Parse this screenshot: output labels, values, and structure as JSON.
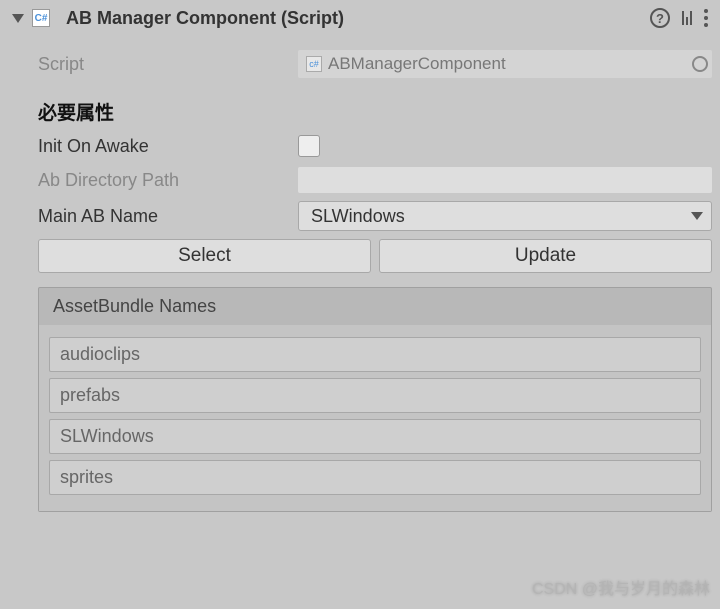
{
  "header": {
    "title": "AB Manager Component (Script)"
  },
  "script": {
    "label": "Script",
    "value": "ABManagerComponent"
  },
  "section_title": "必要属性",
  "fields": {
    "init_on_awake_label": "Init On Awake",
    "ab_dir_label": "Ab Directory Path",
    "ab_dir_value": "",
    "main_ab_label": "Main AB Name",
    "main_ab_value": "SLWindows"
  },
  "buttons": {
    "select": "Select",
    "update": "Update"
  },
  "list": {
    "title": "AssetBundle Names",
    "items": [
      "audioclips",
      "prefabs",
      "SLWindows",
      "sprites"
    ]
  },
  "watermark": "CSDN @我与岁月的森林"
}
